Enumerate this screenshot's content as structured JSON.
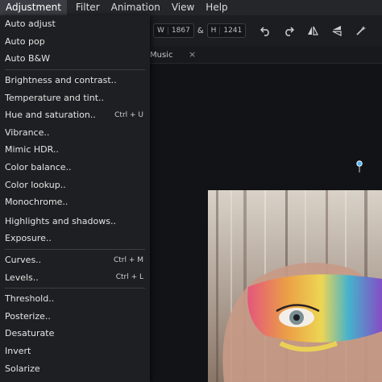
{
  "menubar": {
    "items": [
      "Adjustment",
      "Filter",
      "Animation",
      "View",
      "Help"
    ]
  },
  "toolbar": {
    "width_label": "W",
    "width_value": "1867",
    "link_symbol": "&",
    "height_label": "H",
    "height_value": "1241",
    "icons": [
      "undo-icon",
      "redo-icon",
      "flip-horizontal-icon",
      "flip-vertical-icon",
      "magic-wand-icon"
    ]
  },
  "tab": {
    "label": "Music",
    "close": "×"
  },
  "adjustment_menu": {
    "group1": [
      {
        "label": "Auto adjust",
        "shortcut": ""
      },
      {
        "label": "Auto pop",
        "shortcut": ""
      },
      {
        "label": "Auto B&W",
        "shortcut": ""
      }
    ],
    "group2": [
      {
        "label": "Brightness and contrast..",
        "shortcut": ""
      },
      {
        "label": "Temperature and tint..",
        "shortcut": ""
      },
      {
        "label": "Hue and saturation..",
        "shortcut": "Ctrl + U"
      },
      {
        "label": "Vibrance..",
        "shortcut": ""
      },
      {
        "label": "Mimic HDR..",
        "shortcut": ""
      },
      {
        "label": "Color balance..",
        "shortcut": ""
      },
      {
        "label": "Color lookup..",
        "shortcut": ""
      },
      {
        "label": "Monochrome..",
        "shortcut": ""
      },
      {
        "label": "Highlights and shadows..",
        "shortcut": ""
      },
      {
        "label": "Exposure..",
        "shortcut": ""
      }
    ],
    "group3": [
      {
        "label": "Curves..",
        "shortcut": "Ctrl + M"
      },
      {
        "label": "Levels..",
        "shortcut": "Ctrl + L"
      }
    ],
    "group4": [
      {
        "label": "Threshold..",
        "shortcut": ""
      },
      {
        "label": "Posterize..",
        "shortcut": ""
      },
      {
        "label": "Desaturate",
        "shortcut": ""
      },
      {
        "label": "Invert",
        "shortcut": ""
      },
      {
        "label": "Solarize",
        "shortcut": ""
      }
    ]
  },
  "colors": {
    "menu_bg": "#1e1f22",
    "active_menu": "#3a3d43",
    "canvas_bg": "#121316",
    "pin": "#4ab3ff"
  }
}
